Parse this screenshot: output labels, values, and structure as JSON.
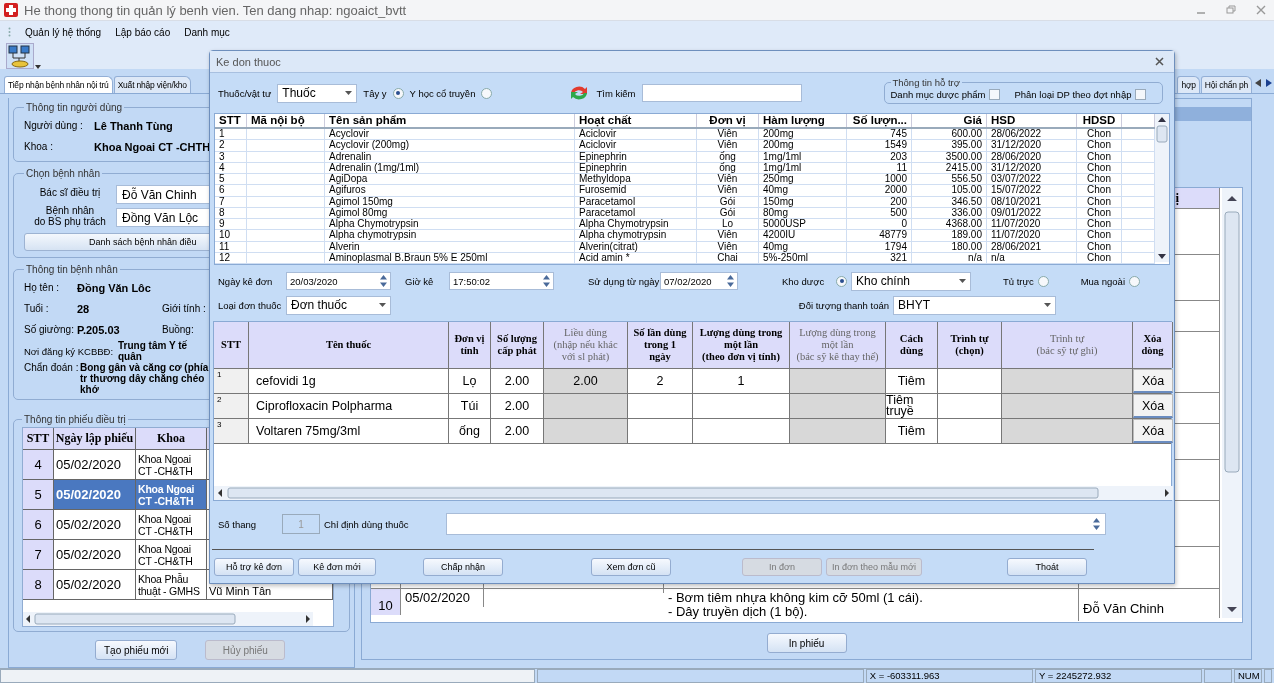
{
  "window": {
    "title": "He thong thong tin quản lý benh vien. Ten dang nhap: ngoaict_bvtt"
  },
  "menu": [
    "Quản lý hệ thống",
    "Lập báo cáo",
    "Danh mục"
  ],
  "tabs": [
    {
      "label": "Tiếp nhận bệnh nhân nội trú",
      "selected": true
    },
    {
      "label": "Xuất nhập viện/kho",
      "selected": false
    }
  ],
  "tabs_right": [
    {
      "label": "hợp",
      "selected": false
    },
    {
      "label": "Hội chẩn ph",
      "selected": false
    }
  ],
  "user_info": {
    "title": "Thông tin người dùng",
    "fields": [
      {
        "label": "Người dùng :",
        "value": "Lê Thanh Tùng"
      },
      {
        "label": "Khoa :",
        "value": "Khoa Ngoai CT -CHTH"
      }
    ]
  },
  "choose_patient": {
    "title": "Chọn bệnh nhân",
    "fields": [
      {
        "label": "Bác sĩ điều trị",
        "value": "Đỗ Văn Chinh"
      },
      {
        "label": "Bệnh nhân\ndo BS phụ trách",
        "value": "Đồng Văn Lộc"
      }
    ],
    "button": "Danh sách bệnh nhân điều"
  },
  "patient_info": {
    "title": "Thông tin bệnh nhân",
    "name_label": "Họ tên :",
    "name": "Đồng Văn Lôc",
    "age_label": "Tuổi :",
    "age": "28",
    "gender_label": "Giới tính :",
    "bed_label": "Số giường:",
    "bed": "P.205.03",
    "room_label": "Buồng:",
    "register_label": "Nơi đăng ký KCBBĐ:",
    "register": "Trung tâm Y tế quân",
    "diagnosis_label": "Chẩn đoán :",
    "diagnosis": "Bong gân và căng cơ (phía tr thương dây chằng chéo khớ"
  },
  "treatment_sheets": {
    "title": "Thông tin phiếu điều trị",
    "columns": [
      "STT",
      "Ngày lập phiếu",
      "Khoa"
    ],
    "rows": [
      {
        "stt": "4",
        "date": "05/02/2020",
        "dept": "Khoa Ngoai CT -CH&TH",
        "selected": false
      },
      {
        "stt": "5",
        "date": "05/02/2020",
        "dept": "Khoa Ngoai CT -CH&TH",
        "selected": true
      },
      {
        "stt": "6",
        "date": "05/02/2020",
        "dept": "Khoa Ngoai CT -CH&TH",
        "selected": false
      },
      {
        "stt": "7",
        "date": "05/02/2020",
        "dept": "Khoa Ngoai CT -CH&TH",
        "selected": false
      },
      {
        "stt": "8",
        "date": "05/02/2020",
        "dept": "Khoa Phẫu thuật - GMHS",
        "column_4": "Vũ Minh Tân",
        "selected": false
      }
    ],
    "buttons": [
      {
        "label": "Tạo phiếu mới",
        "disabled": false
      },
      {
        "label": "Hủy phiếu",
        "disabled": true
      }
    ]
  },
  "orders": {
    "column_5": "ị",
    "row": {
      "stt": "10",
      "date": "05/02/2020",
      "content": "- Bơm tiêm nhựa không kim cỡ 50ml (1 cái).\n- Dây truyền dịch  (1 bộ).",
      "doctor": "Đỗ Văn Chinh"
    },
    "button": "In phiếu"
  },
  "dialog": {
    "title": "Ke don thuoc",
    "type_label": "Thuốc/vật tư",
    "type_value": "Thuốc",
    "radios": [
      {
        "label": "Tây y",
        "selected": true
      },
      {
        "label": "Y học cổ truyền",
        "selected": false
      }
    ],
    "search_label": "Tìm kiếm",
    "support": {
      "title": "Thông tin hỗ trợ",
      "checks": [
        {
          "label": "Danh mục dược phẩm",
          "checked": false
        },
        {
          "label": "Phân loại DP theo đợt nhập",
          "checked": false
        }
      ]
    },
    "drugs": {
      "columns": [
        "STT",
        "Mã nội bộ",
        "Tên sản phẩm",
        "Hoạt chất",
        "Đơn vị",
        "Hàm lượng",
        "Số lượn...",
        "Giá",
        "HSD",
        "HDSD"
      ],
      "rows": [
        {
          "stt": "1",
          "name": "Acyclovir",
          "ingredient": "Aciclovir",
          "unit": "Viên",
          "strength": "200mg",
          "quantity": "745",
          "price": "600.00",
          "expiry": "28/06/2022",
          "usage": "Chon"
        },
        {
          "stt": "2",
          "name": "Acyclovir (200mg)",
          "ingredient": "Aciclovir",
          "unit": "Viên",
          "strength": "200mg",
          "quantity": "1549",
          "price": "395.00",
          "expiry": "31/12/2020",
          "usage": "Chon"
        },
        {
          "stt": "3",
          "name": "Adrenalin",
          "ingredient": "Epinephrin",
          "unit": "ống",
          "strength": "1mg/1ml",
          "quantity": "203",
          "price": "3500.00",
          "expiry": "28/06/2020",
          "usage": "Chon"
        },
        {
          "stt": "4",
          "name": "Adrenalin (1mg/1ml)",
          "ingredient": "Epinephrin",
          "unit": "ống",
          "strength": "1mg/1ml",
          "quantity": "11",
          "price": "2415.00",
          "expiry": "31/12/2020",
          "usage": "Chon"
        },
        {
          "stt": "5",
          "name": "AgiDopa",
          "ingredient": "Methyldopa",
          "unit": "Viên",
          "strength": "250mg",
          "quantity": "1000",
          "price": "556.50",
          "expiry": "03/07/2022",
          "usage": "Chon"
        },
        {
          "stt": "6",
          "name": "Agifuros",
          "ingredient": "Furosemid",
          "unit": "Viên",
          "strength": "40mg",
          "quantity": "2000",
          "price": "105.00",
          "expiry": "15/07/2022",
          "usage": "Chon"
        },
        {
          "stt": "7",
          "name": "Agimol 150mg",
          "ingredient": "Paracetamol",
          "unit": "Gói",
          "strength": "150mg",
          "quantity": "200",
          "price": "346.50",
          "expiry": "08/10/2021",
          "usage": "Chon"
        },
        {
          "stt": "8",
          "name": "Agimol 80mg",
          "ingredient": "Paracetamol",
          "unit": "Gói",
          "strength": "80mg",
          "quantity": "500",
          "price": "336.00",
          "expiry": "09/01/2022",
          "usage": "Chon"
        },
        {
          "stt": "9",
          "name": "Alpha Chymotrypsin",
          "ingredient": "Alpha Chymotrypsin",
          "unit": "Lo",
          "strength": "5000USP",
          "quantity": "0",
          "price": "4368.00",
          "expiry": "11/07/2020",
          "usage": "Chon"
        },
        {
          "stt": "10",
          "name": "Alpha chymotrypsin",
          "ingredient": "Alpha chymotrypsin",
          "unit": "Viên",
          "strength": "4200IU",
          "quantity": "48779",
          "price": "189.00",
          "expiry": "11/07/2020",
          "usage": "Chon"
        },
        {
          "stt": "11",
          "name": "Alverin",
          "ingredient": "Alverin(citrat)",
          "unit": "Viên",
          "strength": "40mg",
          "quantity": "1794",
          "price": "180.00",
          "expiry": "28/06/2021",
          "usage": "Chon"
        },
        {
          "stt": "12",
          "name": "Aminoplasmal B.Braun 5% E 250ml",
          "ingredient": "Acid amin *",
          "unit": "Chai",
          "strength": "5%-250ml",
          "quantity": "321",
          "price": "n/a",
          "expiry": "n/a",
          "usage": "Chon"
        }
      ]
    },
    "form": {
      "date_label": "Ngày kê đơn",
      "date": "20/03/2020",
      "time_label": "Giờ kê",
      "time": "17:50:02",
      "from_label": "Sử dụng từ ngày",
      "from": "07/02/2020",
      "store_label": "Kho dược",
      "store_selected": true,
      "store": "Kho chính",
      "store_radios": [
        {
          "label": "Tủ trực",
          "selected": false
        },
        {
          "label": "Mua ngoài",
          "selected": false
        }
      ],
      "kind_label": "Loại đơn thuốc",
      "kind": "Đơn thuốc",
      "payer_label": "Đối tượng thanh toán",
      "payer": "BHYT"
    },
    "prescription": {
      "columns": [
        {
          "label": "STT",
          "disabled": false
        },
        {
          "label": "Tên thuốc",
          "disabled": false
        },
        {
          "label": "Đơn vị\ntính",
          "disabled": false
        },
        {
          "label": "Số lượng\ncấp phát",
          "disabled": false
        },
        {
          "label": "Liều dùng\n(nhập nếu khác\nvới sl phát)",
          "disabled": true
        },
        {
          "label": "Số lần dùng\ntrong 1\nngày",
          "disabled": false
        },
        {
          "label": "Lượng dùng trong\nmột lần\n(theo đơn vị tính)",
          "disabled": false
        },
        {
          "label": "Lượng dùng trong\nmột lần\n(bác sỹ kê thay thế)",
          "disabled": true
        },
        {
          "label": "Cách\ndùng",
          "disabled": false
        },
        {
          "label": "Trình tự\n(chọn)",
          "disabled": false
        },
        {
          "label": "Trình tự\n(bác sỹ tự ghi)",
          "disabled": true
        },
        {
          "label": "Xóa\ndòng",
          "disabled": false
        }
      ],
      "rows": [
        {
          "cells": [
            {
              "kind": "header",
              "text": "1",
              "disabled": false
            },
            {
              "kind": "text",
              "text": "cefovidi 1g",
              "disabled": false
            },
            {
              "kind": "text",
              "text": "Lọ",
              "disabled": false
            },
            {
              "kind": "text",
              "text": "2.00",
              "disabled": false
            },
            {
              "kind": "text",
              "text": "2.00",
              "disabled": true
            },
            {
              "kind": "text",
              "text": "2",
              "disabled": false
            },
            {
              "kind": "text",
              "text": "1",
              "disabled": false
            },
            {
              "kind": "text",
              "disabled": true
            },
            {
              "kind": "text",
              "text": "Tiêm",
              "disabled": false
            },
            {
              "kind": "text",
              "disabled": false
            },
            {
              "kind": "text",
              "disabled": true
            },
            {
              "kind": "button",
              "text": "Xóa",
              "disabled": false
            }
          ]
        },
        {
          "cells": [
            {
              "kind": "header",
              "text": "2",
              "disabled": false
            },
            {
              "kind": "text",
              "text": "Ciprofloxacin  Polpharma",
              "disabled": false
            },
            {
              "kind": "text",
              "text": "Túi",
              "disabled": false
            },
            {
              "kind": "text",
              "text": "2.00",
              "disabled": false
            },
            {
              "kind": "text",
              "disabled": true
            },
            {
              "kind": "text",
              "disabled": false
            },
            {
              "kind": "text",
              "disabled": false
            },
            {
              "kind": "text",
              "disabled": true
            },
            {
              "kind": "text",
              "text": "Tiêm truyề",
              "disabled": false
            },
            {
              "kind": "text",
              "disabled": false
            },
            {
              "kind": "text",
              "disabled": true
            },
            {
              "kind": "button",
              "text": "Xóa",
              "disabled": false
            }
          ]
        },
        {
          "cells": [
            {
              "kind": "header",
              "text": "3",
              "disabled": false
            },
            {
              "kind": "text",
              "text": "Voltaren 75mg/3ml",
              "disabled": false
            },
            {
              "kind": "text",
              "text": "ống",
              "disabled": false
            },
            {
              "kind": "text",
              "text": "2.00",
              "disabled": false
            },
            {
              "kind": "text",
              "disabled": true
            },
            {
              "kind": "text",
              "disabled": false
            },
            {
              "kind": "text",
              "disabled": false
            },
            {
              "kind": "text",
              "disabled": true
            },
            {
              "kind": "text",
              "text": "Tiêm",
              "disabled": false
            },
            {
              "kind": "text",
              "disabled": false
            },
            {
              "kind": "text",
              "disabled": true
            },
            {
              "kind": "button",
              "text": "Xóa",
              "disabled": false
            }
          ]
        }
      ]
    },
    "packs_label": "Số thang",
    "packs": "1",
    "instruction_label": "Chỉ định dùng thuốc",
    "buttons": [
      {
        "label": "Hỗ trợ kê đơn",
        "disabled": false
      },
      {
        "label": "Kê đơn mới",
        "disabled": false
      },
      {
        "label": "Chấp nhận",
        "disabled": false
      },
      {
        "label": "Xem đơn cũ",
        "disabled": false
      },
      {
        "label": "In đơn",
        "disabled": true
      },
      {
        "label": "In đơn theo mẫu mới",
        "disabled": true
      },
      {
        "label": "Thoát",
        "disabled": false
      }
    ]
  },
  "status_bar": {
    "x": "X = -603311.963",
    "y": "Y = 2245272.932",
    "num": "NUM"
  }
}
